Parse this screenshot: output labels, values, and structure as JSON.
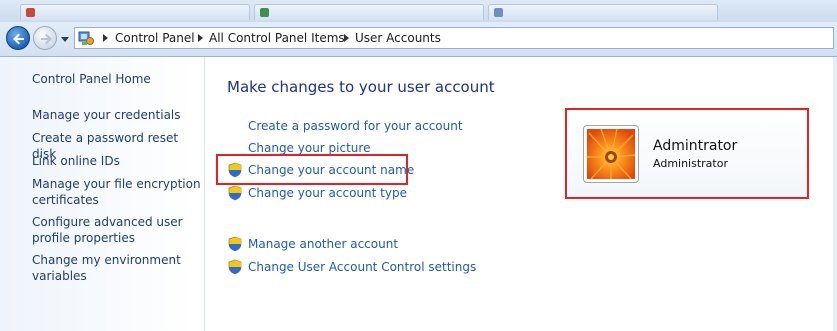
{
  "window": {
    "tabs": [
      "",
      "",
      ""
    ]
  },
  "navbar": {
    "breadcrumb": [
      "Control Panel",
      "All Control Panel Items",
      "User Accounts"
    ]
  },
  "sidebar": {
    "items": [
      {
        "label": "Control Panel Home"
      },
      {
        "label": "Manage your credentials"
      },
      {
        "label": "Create a password reset disk"
      },
      {
        "label": "Link online IDs"
      },
      {
        "label": "Manage your file encryption certificates"
      },
      {
        "label": "Configure advanced user profile properties"
      },
      {
        "label": "Change my environment variables"
      }
    ]
  },
  "main": {
    "title": "Make changes to your user account",
    "links": [
      {
        "label": "Create a password for your account",
        "shield": false
      },
      {
        "label": "Change your picture",
        "shield": false
      },
      {
        "label": "Change your account name",
        "shield": true,
        "highlighted": true
      },
      {
        "label": "Change your account type",
        "shield": true
      }
    ],
    "other_links": [
      {
        "label": "Manage another account",
        "shield": true
      },
      {
        "label": "Change User Account Control settings",
        "shield": true
      }
    ]
  },
  "account": {
    "name": "Admintrator",
    "type": "Administrator",
    "highlighted": true
  },
  "colors": {
    "highlight_border": "#e0232b",
    "link": "#1f5bad",
    "title": "#1e3287"
  },
  "icons": {
    "back": "back-arrow-icon",
    "forward": "forward-arrow-icon",
    "control_panel": "control-panel-icon",
    "uac": "uac-shield-icon",
    "account_picture": "flower-picture"
  }
}
